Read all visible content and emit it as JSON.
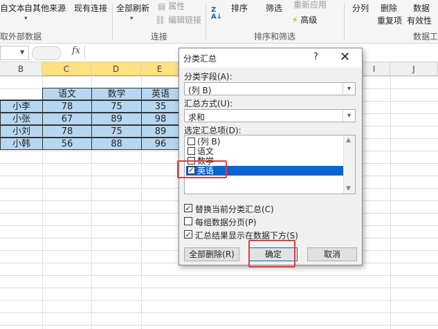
{
  "ribbon": {
    "get_external": "取外部数据",
    "from_text": "自文本",
    "from_other": "自其他来源",
    "existing": "现有连接",
    "refresh_all": "全部刷新",
    "properties": "属性",
    "edit_links": "编辑链接",
    "connections_label": "连接",
    "sort": "排序",
    "filter": "筛选",
    "reapply": "重新应用",
    "advanced": "高级",
    "sort_filter_label": "排序和筛选",
    "text_to_columns": "分列",
    "remove_dup_1": "删除",
    "remove_dup_2": "重复项",
    "data_validation_1": "数据",
    "data_validation_2": "有效性",
    "data_tools_label": "数据工"
  },
  "formula_bar": {
    "fx": "fx"
  },
  "columns": [
    "B",
    "C",
    "D",
    "E",
    "I",
    "J"
  ],
  "table": {
    "headers": [
      "语文",
      "数学",
      "英语"
    ],
    "rows": [
      {
        "name": "小李",
        "v": [
          "78",
          "75",
          "35"
        ]
      },
      {
        "name": "小张",
        "v": [
          "67",
          "89",
          "98"
        ]
      },
      {
        "name": "小刘",
        "v": [
          "78",
          "75",
          "89"
        ]
      },
      {
        "name": "小韩",
        "v": [
          "56",
          "88",
          "96"
        ]
      }
    ]
  },
  "dialog": {
    "title": "分类汇总",
    "help": "?",
    "close": "✕",
    "field_label": "分类字段(A):",
    "field_value": "(列 B)",
    "func_label": "汇总方式(U):",
    "func_value": "求和",
    "items_label": "选定汇总项(D):",
    "items": [
      {
        "label": "(列 B)",
        "checked": "",
        "selected": false
      },
      {
        "label": "语文",
        "checked": "",
        "selected": false
      },
      {
        "label": "数学",
        "checked": "",
        "selected": false
      },
      {
        "label": "英语",
        "checked": "✓",
        "selected": true
      }
    ],
    "opt_replace": "替换当前分类汇总(C)",
    "opt_pagebreak": "每组数据分页(P)",
    "opt_below": "汇总结果显示在数据下方(S)",
    "check_on": "✓",
    "btn_remove_all": "全部删除(R)",
    "btn_ok": "确定",
    "btn_cancel": "取消"
  },
  "colors": {
    "accent_blue": "#0a64d2",
    "cell_blue": "#b7d7f1",
    "highlight_red": "#e23b3b"
  }
}
